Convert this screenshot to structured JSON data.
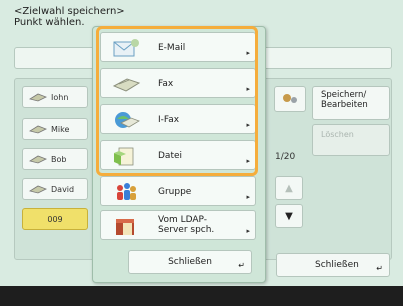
{
  "header": {
    "line1": "<Zielwahl speichern>",
    "line2": "Punkt wählen."
  },
  "entries": [
    "Iohn",
    "Mike",
    "Bob",
    "David",
    "009"
  ],
  "right_panel": {
    "save_line1": "Speichern/",
    "save_line2": "Bearbeiten",
    "delete_label": "Löschen",
    "counter": "1/20",
    "close_label": "Schließen"
  },
  "popup": {
    "items": [
      {
        "label": "E-Mail",
        "icon": "email-icon"
      },
      {
        "label": "Fax",
        "icon": "fax-icon"
      },
      {
        "label": "I-Fax",
        "icon": "ifax-icon"
      },
      {
        "label": "Datei",
        "icon": "file-icon"
      },
      {
        "label": "Gruppe",
        "icon": "group-icon"
      },
      {
        "label_line1": "Vom LDAP-",
        "label_line2": "Server spch.",
        "icon": "ldap-server-icon"
      }
    ],
    "close_label": "Schließen"
  },
  "colors": {
    "accent": "#f5ad3c",
    "screen_bg": "#d9ebe1",
    "selected_entry": "#f0e06a"
  }
}
